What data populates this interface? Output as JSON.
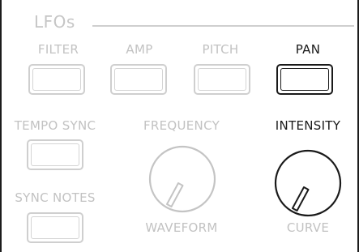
{
  "section": {
    "title": "LFOs"
  },
  "targets": [
    {
      "label": "FILTER",
      "active": false
    },
    {
      "label": "AMP",
      "active": false
    },
    {
      "label": "PITCH",
      "active": false
    },
    {
      "label": "PAN",
      "active": true
    }
  ],
  "tempo_sync": {
    "label": "TEMPO SYNC"
  },
  "sync_notes": {
    "label": "SYNC NOTES"
  },
  "knobs": {
    "frequency": {
      "label": "FREQUENCY",
      "sub_label": "WAVEFORM",
      "active": false
    },
    "intensity": {
      "label": "INTENSITY",
      "sub_label": "CURVE",
      "active": true
    }
  },
  "colors": {
    "active": "#1a1a1a",
    "inactive": "#c4c4c4"
  }
}
